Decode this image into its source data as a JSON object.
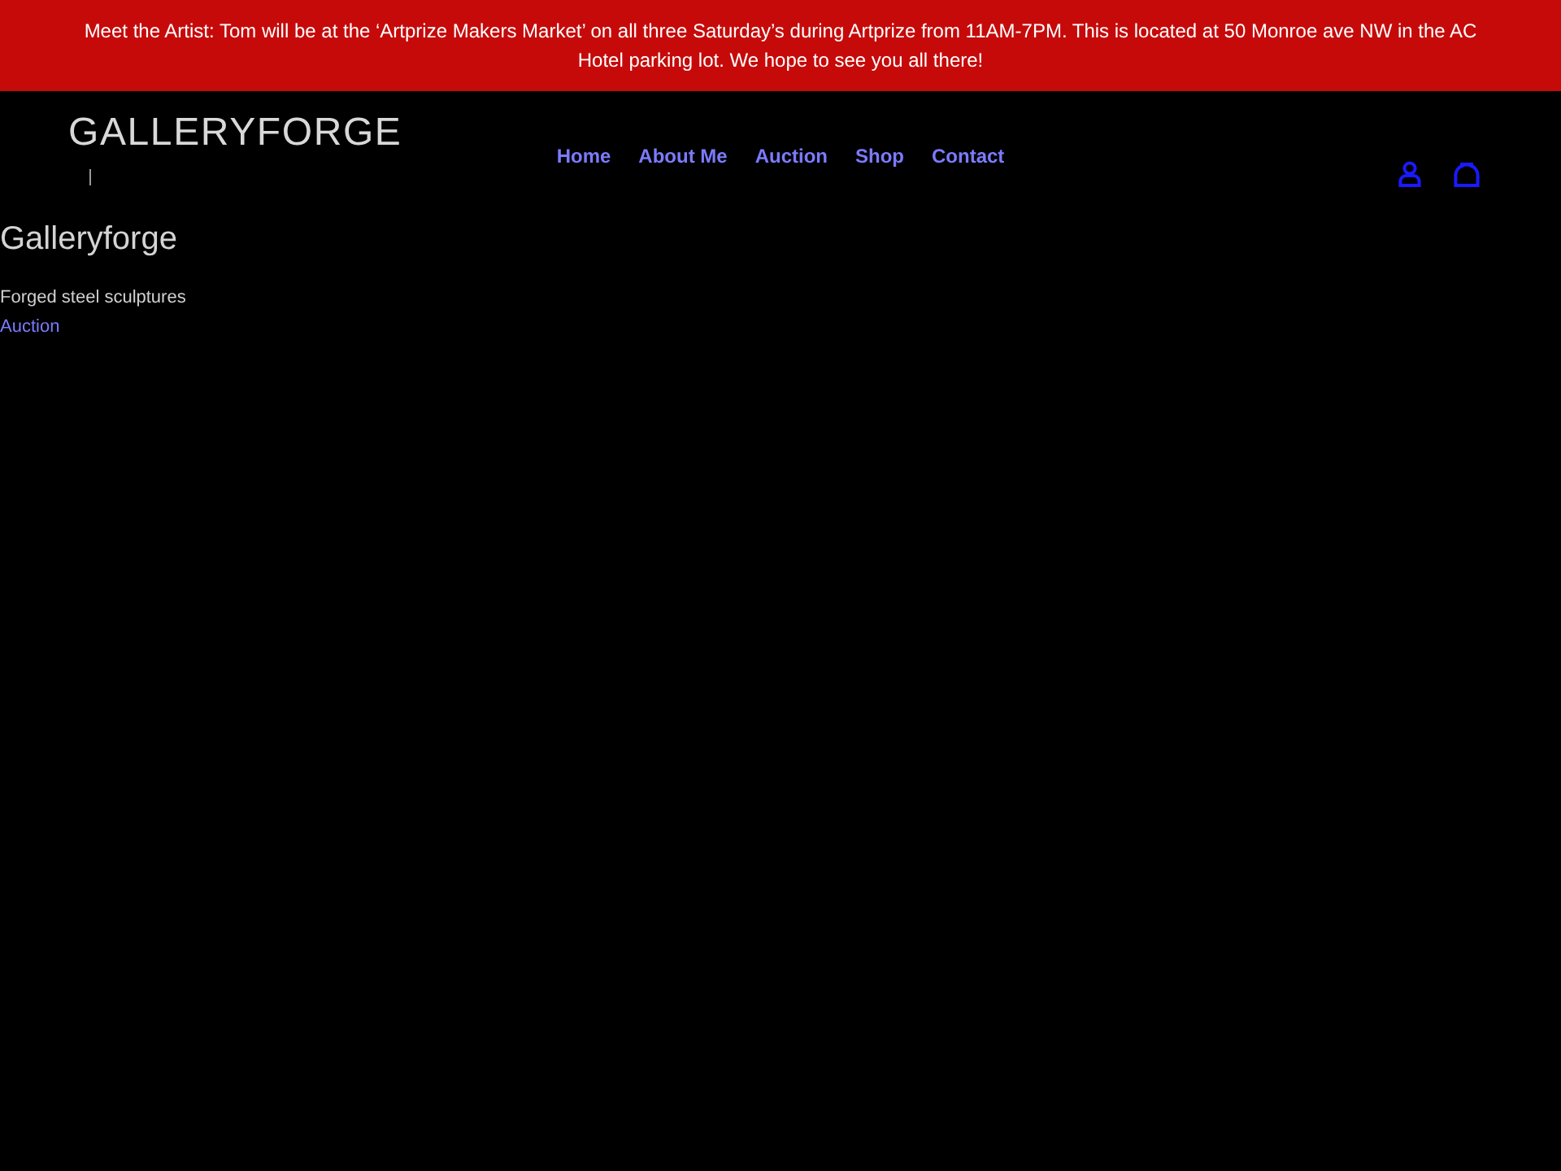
{
  "announcement": {
    "text": "Meet the Artist: Tom will be at the ‘Artprize Makers Market’ on all three Saturday’s during Artprize from 11AM-7PM. This is located at 50 Monroe ave NW in the AC Hotel parking lot. We hope to see you all there!"
  },
  "header": {
    "logo": "GALLERYFORGE",
    "nav": [
      "Home",
      "About Me",
      "Auction",
      "Shop",
      "Contact"
    ]
  },
  "main": {
    "title": "Galleryforge",
    "tagline": "Forged steel sculptures",
    "link": "Auction"
  }
}
